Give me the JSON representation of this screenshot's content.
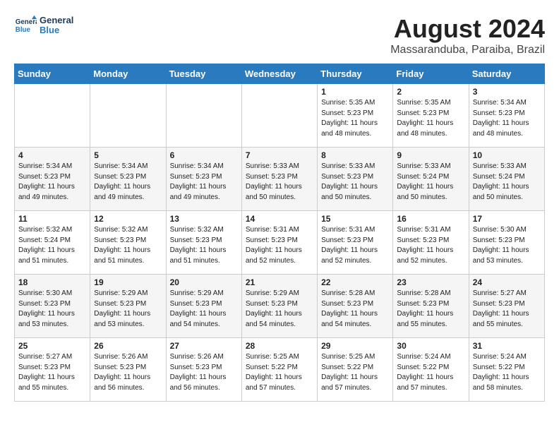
{
  "logo": {
    "line1": "General",
    "line2": "Blue"
  },
  "title": "August 2024",
  "subtitle": "Massaranduba, Paraiba, Brazil",
  "weekdays": [
    "Sunday",
    "Monday",
    "Tuesday",
    "Wednesday",
    "Thursday",
    "Friday",
    "Saturday"
  ],
  "weeks": [
    [
      {
        "day": "",
        "info": ""
      },
      {
        "day": "",
        "info": ""
      },
      {
        "day": "",
        "info": ""
      },
      {
        "day": "",
        "info": ""
      },
      {
        "day": "1",
        "info": "Sunrise: 5:35 AM\nSunset: 5:23 PM\nDaylight: 11 hours\nand 48 minutes."
      },
      {
        "day": "2",
        "info": "Sunrise: 5:35 AM\nSunset: 5:23 PM\nDaylight: 11 hours\nand 48 minutes."
      },
      {
        "day": "3",
        "info": "Sunrise: 5:34 AM\nSunset: 5:23 PM\nDaylight: 11 hours\nand 48 minutes."
      }
    ],
    [
      {
        "day": "4",
        "info": "Sunrise: 5:34 AM\nSunset: 5:23 PM\nDaylight: 11 hours\nand 49 minutes."
      },
      {
        "day": "5",
        "info": "Sunrise: 5:34 AM\nSunset: 5:23 PM\nDaylight: 11 hours\nand 49 minutes."
      },
      {
        "day": "6",
        "info": "Sunrise: 5:34 AM\nSunset: 5:23 PM\nDaylight: 11 hours\nand 49 minutes."
      },
      {
        "day": "7",
        "info": "Sunrise: 5:33 AM\nSunset: 5:23 PM\nDaylight: 11 hours\nand 50 minutes."
      },
      {
        "day": "8",
        "info": "Sunrise: 5:33 AM\nSunset: 5:23 PM\nDaylight: 11 hours\nand 50 minutes."
      },
      {
        "day": "9",
        "info": "Sunrise: 5:33 AM\nSunset: 5:24 PM\nDaylight: 11 hours\nand 50 minutes."
      },
      {
        "day": "10",
        "info": "Sunrise: 5:33 AM\nSunset: 5:24 PM\nDaylight: 11 hours\nand 50 minutes."
      }
    ],
    [
      {
        "day": "11",
        "info": "Sunrise: 5:32 AM\nSunset: 5:24 PM\nDaylight: 11 hours\nand 51 minutes."
      },
      {
        "day": "12",
        "info": "Sunrise: 5:32 AM\nSunset: 5:23 PM\nDaylight: 11 hours\nand 51 minutes."
      },
      {
        "day": "13",
        "info": "Sunrise: 5:32 AM\nSunset: 5:23 PM\nDaylight: 11 hours\nand 51 minutes."
      },
      {
        "day": "14",
        "info": "Sunrise: 5:31 AM\nSunset: 5:23 PM\nDaylight: 11 hours\nand 52 minutes."
      },
      {
        "day": "15",
        "info": "Sunrise: 5:31 AM\nSunset: 5:23 PM\nDaylight: 11 hours\nand 52 minutes."
      },
      {
        "day": "16",
        "info": "Sunrise: 5:31 AM\nSunset: 5:23 PM\nDaylight: 11 hours\nand 52 minutes."
      },
      {
        "day": "17",
        "info": "Sunrise: 5:30 AM\nSunset: 5:23 PM\nDaylight: 11 hours\nand 53 minutes."
      }
    ],
    [
      {
        "day": "18",
        "info": "Sunrise: 5:30 AM\nSunset: 5:23 PM\nDaylight: 11 hours\nand 53 minutes."
      },
      {
        "day": "19",
        "info": "Sunrise: 5:29 AM\nSunset: 5:23 PM\nDaylight: 11 hours\nand 53 minutes."
      },
      {
        "day": "20",
        "info": "Sunrise: 5:29 AM\nSunset: 5:23 PM\nDaylight: 11 hours\nand 54 minutes."
      },
      {
        "day": "21",
        "info": "Sunrise: 5:29 AM\nSunset: 5:23 PM\nDaylight: 11 hours\nand 54 minutes."
      },
      {
        "day": "22",
        "info": "Sunrise: 5:28 AM\nSunset: 5:23 PM\nDaylight: 11 hours\nand 54 minutes."
      },
      {
        "day": "23",
        "info": "Sunrise: 5:28 AM\nSunset: 5:23 PM\nDaylight: 11 hours\nand 55 minutes."
      },
      {
        "day": "24",
        "info": "Sunrise: 5:27 AM\nSunset: 5:23 PM\nDaylight: 11 hours\nand 55 minutes."
      }
    ],
    [
      {
        "day": "25",
        "info": "Sunrise: 5:27 AM\nSunset: 5:23 PM\nDaylight: 11 hours\nand 55 minutes."
      },
      {
        "day": "26",
        "info": "Sunrise: 5:26 AM\nSunset: 5:23 PM\nDaylight: 11 hours\nand 56 minutes."
      },
      {
        "day": "27",
        "info": "Sunrise: 5:26 AM\nSunset: 5:23 PM\nDaylight: 11 hours\nand 56 minutes."
      },
      {
        "day": "28",
        "info": "Sunrise: 5:25 AM\nSunset: 5:22 PM\nDaylight: 11 hours\nand 57 minutes."
      },
      {
        "day": "29",
        "info": "Sunrise: 5:25 AM\nSunset: 5:22 PM\nDaylight: 11 hours\nand 57 minutes."
      },
      {
        "day": "30",
        "info": "Sunrise: 5:24 AM\nSunset: 5:22 PM\nDaylight: 11 hours\nand 57 minutes."
      },
      {
        "day": "31",
        "info": "Sunrise: 5:24 AM\nSunset: 5:22 PM\nDaylight: 11 hours\nand 58 minutes."
      }
    ]
  ]
}
